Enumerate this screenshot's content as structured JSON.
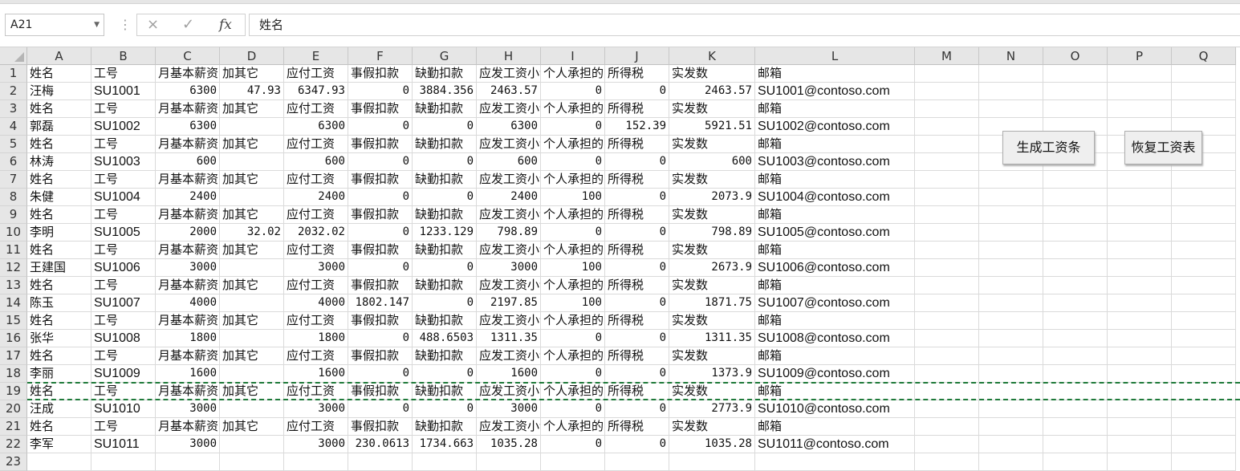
{
  "namebox": {
    "value": "A21",
    "dropdown_icon": "chevron-down-icon"
  },
  "formula_bar": {
    "cancel_icon": "×",
    "enter_icon": "✓",
    "fx_label": "fx",
    "content": "姓名"
  },
  "columns": [
    "A",
    "B",
    "C",
    "D",
    "E",
    "F",
    "G",
    "H",
    "I",
    "J",
    "K",
    "L",
    "M",
    "N",
    "O",
    "P",
    "Q"
  ],
  "rows": [
    [
      "姓名",
      "工号",
      "月基本薪资",
      "加其它",
      "应付工资",
      "事假扣款",
      "缺勤扣款",
      "应发工资小计",
      "个人承担的",
      "所得税",
      "实发数",
      "邮箱"
    ],
    [
      "汪梅",
      "SU1001",
      "6300",
      "47.93",
      "6347.93",
      "0",
      "3884.356",
      "2463.57",
      "0",
      "0",
      "2463.57",
      "SU1001@contoso.com"
    ],
    [
      "姓名",
      "工号",
      "月基本薪资",
      "加其它",
      "应付工资",
      "事假扣款",
      "缺勤扣款",
      "应发工资小计",
      "个人承担的",
      "所得税",
      "实发数",
      "邮箱"
    ],
    [
      "郭磊",
      "SU1002",
      "6300",
      "",
      "6300",
      "0",
      "0",
      "6300",
      "0",
      "152.39",
      "5921.51",
      "SU1002@contoso.com"
    ],
    [
      "姓名",
      "工号",
      "月基本薪资",
      "加其它",
      "应付工资",
      "事假扣款",
      "缺勤扣款",
      "应发工资小计",
      "个人承担的",
      "所得税",
      "实发数",
      "邮箱"
    ],
    [
      "林涛",
      "SU1003",
      "600",
      "",
      "600",
      "0",
      "0",
      "600",
      "0",
      "0",
      "600",
      "SU1003@contoso.com"
    ],
    [
      "姓名",
      "工号",
      "月基本薪资",
      "加其它",
      "应付工资",
      "事假扣款",
      "缺勤扣款",
      "应发工资小计",
      "个人承担的",
      "所得税",
      "实发数",
      "邮箱"
    ],
    [
      "朱健",
      "SU1004",
      "2400",
      "",
      "2400",
      "0",
      "0",
      "2400",
      "100",
      "0",
      "2073.9",
      "SU1004@contoso.com"
    ],
    [
      "姓名",
      "工号",
      "月基本薪资",
      "加其它",
      "应付工资",
      "事假扣款",
      "缺勤扣款",
      "应发工资小计",
      "个人承担的",
      "所得税",
      "实发数",
      "邮箱"
    ],
    [
      "李明",
      "SU1005",
      "2000",
      "32.02",
      "2032.02",
      "0",
      "1233.129",
      "798.89",
      "0",
      "0",
      "798.89",
      "SU1005@contoso.com"
    ],
    [
      "姓名",
      "工号",
      "月基本薪资",
      "加其它",
      "应付工资",
      "事假扣款",
      "缺勤扣款",
      "应发工资小计",
      "个人承担的",
      "所得税",
      "实发数",
      "邮箱"
    ],
    [
      "王建国",
      "SU1006",
      "3000",
      "",
      "3000",
      "0",
      "0",
      "3000",
      "100",
      "0",
      "2673.9",
      "SU1006@contoso.com"
    ],
    [
      "姓名",
      "工号",
      "月基本薪资",
      "加其它",
      "应付工资",
      "事假扣款",
      "缺勤扣款",
      "应发工资小计",
      "个人承担的",
      "所得税",
      "实发数",
      "邮箱"
    ],
    [
      "陈玉",
      "SU1007",
      "4000",
      "",
      "4000",
      "1802.147",
      "0",
      "2197.85",
      "100",
      "0",
      "1871.75",
      "SU1007@contoso.com"
    ],
    [
      "姓名",
      "工号",
      "月基本薪资",
      "加其它",
      "应付工资",
      "事假扣款",
      "缺勤扣款",
      "应发工资小计",
      "个人承担的",
      "所得税",
      "实发数",
      "邮箱"
    ],
    [
      "张华",
      "SU1008",
      "1800",
      "",
      "1800",
      "0",
      "488.6503",
      "1311.35",
      "0",
      "0",
      "1311.35",
      "SU1008@contoso.com"
    ],
    [
      "姓名",
      "工号",
      "月基本薪资",
      "加其它",
      "应付工资",
      "事假扣款",
      "缺勤扣款",
      "应发工资小计",
      "个人承担的",
      "所得税",
      "实发数",
      "邮箱"
    ],
    [
      "李丽",
      "SU1009",
      "1600",
      "",
      "1600",
      "0",
      "0",
      "1600",
      "0",
      "0",
      "1373.9",
      "SU1009@contoso.com"
    ],
    [
      "姓名",
      "工号",
      "月基本薪资",
      "加其它",
      "应付工资",
      "事假扣款",
      "缺勤扣款",
      "应发工资小计",
      "个人承担的",
      "所得税",
      "实发数",
      "邮箱"
    ],
    [
      "汪成",
      "SU1010",
      "3000",
      "",
      "3000",
      "0",
      "0",
      "3000",
      "0",
      "0",
      "2773.9",
      "SU1010@contoso.com"
    ],
    [
      "姓名",
      "工号",
      "月基本薪资",
      "加其它",
      "应付工资",
      "事假扣款",
      "缺勤扣款",
      "应发工资小计",
      "个人承担的",
      "所得税",
      "实发数",
      "邮箱"
    ],
    [
      "李军",
      "SU1011",
      "3000",
      "",
      "3000",
      "230.0613",
      "1734.663",
      "1035.28",
      "0",
      "0",
      "1035.28",
      "SU1011@contoso.com"
    ],
    []
  ],
  "buttons": {
    "generate_label": "生成工资条",
    "restore_label": "恢复工资表"
  },
  "copy_marquee_row": 19,
  "accent_color": "#1f7a3a"
}
